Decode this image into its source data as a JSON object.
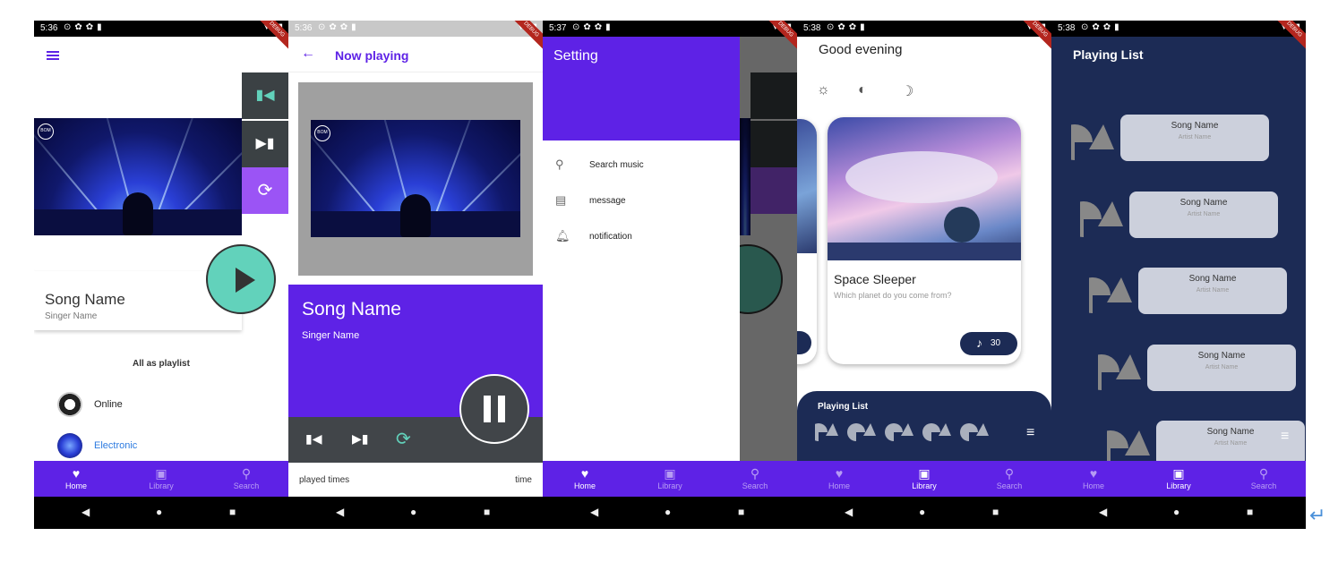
{
  "colors": {
    "primary": "#5e22e6",
    "accent": "#62d2bb",
    "navy": "#1c2b55"
  },
  "status": {
    "s1": "5:36",
    "s2": "5:36",
    "s3": "5:37",
    "s4": "5:38",
    "s5": "5:38"
  },
  "debug": "DEBUG",
  "nav": {
    "home": "Home",
    "library": "Library",
    "search": "Search"
  },
  "screen1": {
    "icons": {
      "menu": "menu-icon",
      "prev": "skip-previous-icon",
      "next": "skip-next-icon",
      "repeat": "repeat-icon",
      "play": "play-icon"
    },
    "song": "Song Name",
    "singer": "Singer Name",
    "section": "All as playlist",
    "playlists": [
      "Online",
      "Electronic"
    ]
  },
  "screen2": {
    "title": "Now playing",
    "song": "Song Name",
    "singer": "Singer Name",
    "played_times": "played times",
    "time": "time"
  },
  "screen3": {
    "title": "Setting",
    "items": [
      "Search music",
      "message",
      "notification"
    ]
  },
  "screen4": {
    "greeting": "Good evening",
    "card_title": "Space Sleeper",
    "card_sub": "Which planet do you come from?",
    "count": "30",
    "playlist_title": "Playing List"
  },
  "screen5": {
    "title": "Playing List",
    "items": [
      {
        "song": "Song Name",
        "artist": "Artist Name"
      },
      {
        "song": "Song Name",
        "artist": "Artist Name"
      },
      {
        "song": "Song Name",
        "artist": "Artist Name"
      },
      {
        "song": "Song Name",
        "artist": "Artist Name"
      },
      {
        "song": "Song Name",
        "artist": "Artist Name"
      }
    ]
  }
}
